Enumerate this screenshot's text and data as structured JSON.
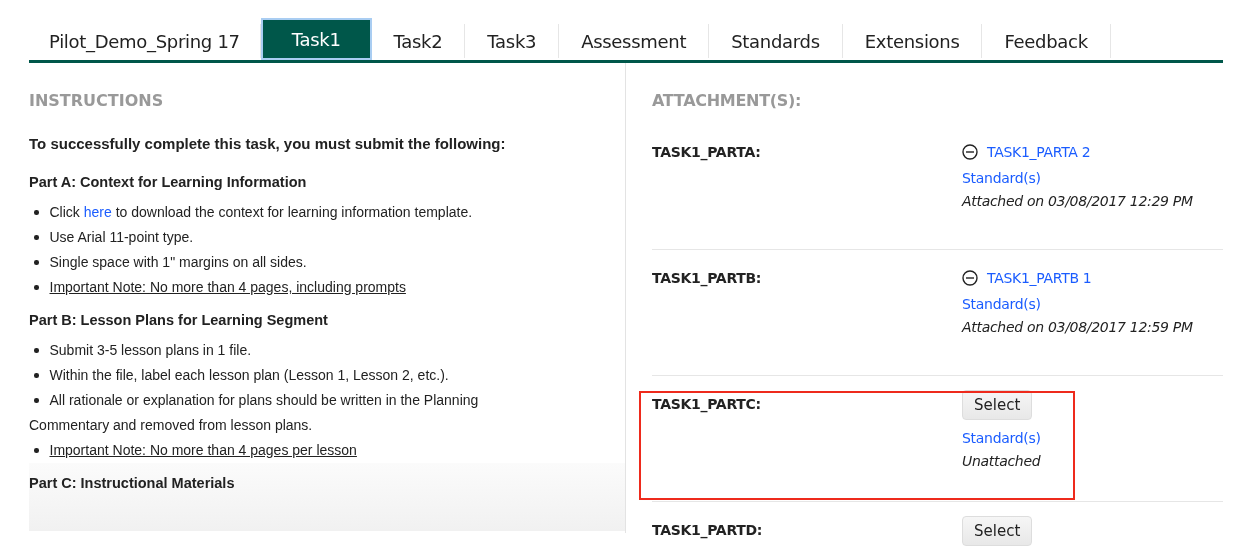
{
  "tabs": [
    {
      "label": "Pilot_Demo_Spring 17",
      "selected": false
    },
    {
      "label": "Task1",
      "selected": true
    },
    {
      "label": "Task2",
      "selected": false
    },
    {
      "label": "Task3",
      "selected": false
    },
    {
      "label": "Assessment",
      "selected": false
    },
    {
      "label": "Standards",
      "selected": false
    },
    {
      "label": "Extensions",
      "selected": false
    },
    {
      "label": "Feedback",
      "selected": false
    }
  ],
  "instructions": {
    "title": "INSTRUCTIONS",
    "intro": "To successfully complete this task, you must submit the following:",
    "sections": [
      {
        "heading": "Part A: Context for Learning Information",
        "items": [
          {
            "kind": "bullet",
            "before": "Click ",
            "link": "here",
            "after": " to download the context for learning information template.",
            "underlined": false
          },
          {
            "kind": "bullet",
            "before": "Use Arial 11-point type.",
            "underlined": false
          },
          {
            "kind": "bullet",
            "before": "Single space with 1\" margins on all sides.",
            "underlined": false
          },
          {
            "kind": "bullet",
            "before": "Important Note: No more than 4 pages, including prompts",
            "underlined": true
          }
        ]
      },
      {
        "heading": "Part B: Lesson Plans for Learning Segment",
        "items": [
          {
            "kind": "bullet",
            "before": "Submit 3-5 lesson plans in 1 file.",
            "underlined": false
          },
          {
            "kind": "bullet",
            "before": "Within the file, label each lesson plan (Lesson 1, Lesson 2, etc.).",
            "underlined": false
          },
          {
            "kind": "bullet",
            "before": "All rationale or explanation for plans should be written in the Planning",
            "underlined": false
          },
          {
            "kind": "plain",
            "before": "Commentary and removed from lesson plans.",
            "underlined": false
          },
          {
            "kind": "bullet",
            "before": "Important Note: No more than 4 pages per lesson",
            "underlined": true
          }
        ]
      },
      {
        "heading": "Part C: Instructional Materials"
      }
    ]
  },
  "attachments": {
    "title": "ATTACHMENT(S):",
    "rows": [
      {
        "label": "TASK1_PARTA:",
        "kind": "attached",
        "file": "TASK1_PARTA 2",
        "standards": "Standard(s)",
        "status": "Attached on 03/08/2017 12:29 PM",
        "highlighted": false
      },
      {
        "label": "TASK1_PARTB:",
        "kind": "attached",
        "file": "TASK1_PARTB 1",
        "standards": "Standard(s)",
        "status": "Attached on 03/08/2017 12:59 PM",
        "highlighted": false
      },
      {
        "label": "TASK1_PARTC:",
        "kind": "unattached",
        "button": "Select",
        "standards": "Standard(s)",
        "status": "Unattached",
        "highlighted": true
      },
      {
        "label": "TASK1_PARTD:",
        "kind": "unattached",
        "button": "Select",
        "highlighted": false
      }
    ]
  }
}
